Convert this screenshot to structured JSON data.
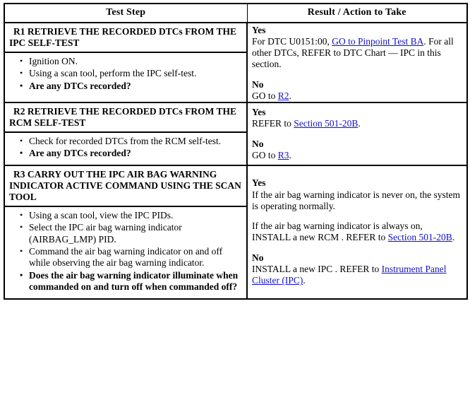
{
  "table": {
    "columns": [
      {
        "label": "Test Step"
      },
      {
        "label": "Result / Action to Take"
      }
    ],
    "link_color": "#1111cc",
    "rows": [
      {
        "id": "R1",
        "step": {
          "title": "R1 RETRIEVE THE RECORDED DTCs FROM THE IPC SELF-TEST",
          "bullets": [
            {
              "text": "Ignition ON.",
              "bold": false
            },
            {
              "text": "Using a scan tool, perform the IPC self-test.",
              "bold": false
            },
            {
              "text": "Are any DTCs recorded?",
              "bold": true
            }
          ]
        },
        "result": {
          "yes_label": "Yes",
          "yes_text_before_link": "For DTC U0151:00, ",
          "yes_link": "GO to Pinpoint Test BA",
          "yes_text_after_link": ". For all other DTCs, REFER to DTC Chart — IPC in this section.",
          "no_label": "No",
          "no_text_before_link": "GO to ",
          "no_link": "R2",
          "no_text_after_link": "."
        }
      },
      {
        "id": "R2",
        "step": {
          "title": "R2 RETRIEVE THE RECORDED DTCs FROM THE RCM SELF-TEST",
          "bullets": [
            {
              "text": "Check for recorded DTCs from the RCM self-test.",
              "bold": false
            },
            {
              "text": "Are any DTCs recorded?",
              "bold": true
            }
          ]
        },
        "result": {
          "yes_label": "Yes",
          "yes_text_before_link": "REFER to ",
          "yes_link": "Section 501-20B",
          "yes_text_after_link": ".",
          "no_label": "No",
          "no_text_before_link": "GO to ",
          "no_link": "R3",
          "no_text_after_link": "."
        }
      },
      {
        "id": "R3",
        "step": {
          "title": "R3 CARRY OUT THE IPC AIR BAG WARNING INDICATOR ACTIVE COMMAND USING THE SCAN TOOL",
          "bullets": [
            {
              "text": "Using a scan tool, view the IPC PIDs.",
              "bold": false
            },
            {
              "text": "Select the IPC air bag warning indicator (AIRBAG_LMP) PID.",
              "bold": false
            },
            {
              "text": "Command the air bag warning indicator on and off while observing the air bag warning indicator.",
              "bold": false
            },
            {
              "text": "Does the air bag warning indicator illuminate when commanded on and turn off when commanded off?",
              "bold": true
            }
          ]
        },
        "result": {
          "yes_label": "Yes",
          "yes_text_line1": "If the air bag warning indicator is never on, the system is operating normally.",
          "yes_text_before_link": "If the air bag warning indicator is always on, INSTALL a new RCM . REFER to ",
          "yes_link": "Section 501-20B",
          "yes_text_after_link": ".",
          "no_label": "No",
          "no_text_before_link": "INSTALL a new IPC . REFER to ",
          "no_link": "Instrument Panel Cluster (IPC)",
          "no_text_after_link": "."
        }
      }
    ]
  }
}
